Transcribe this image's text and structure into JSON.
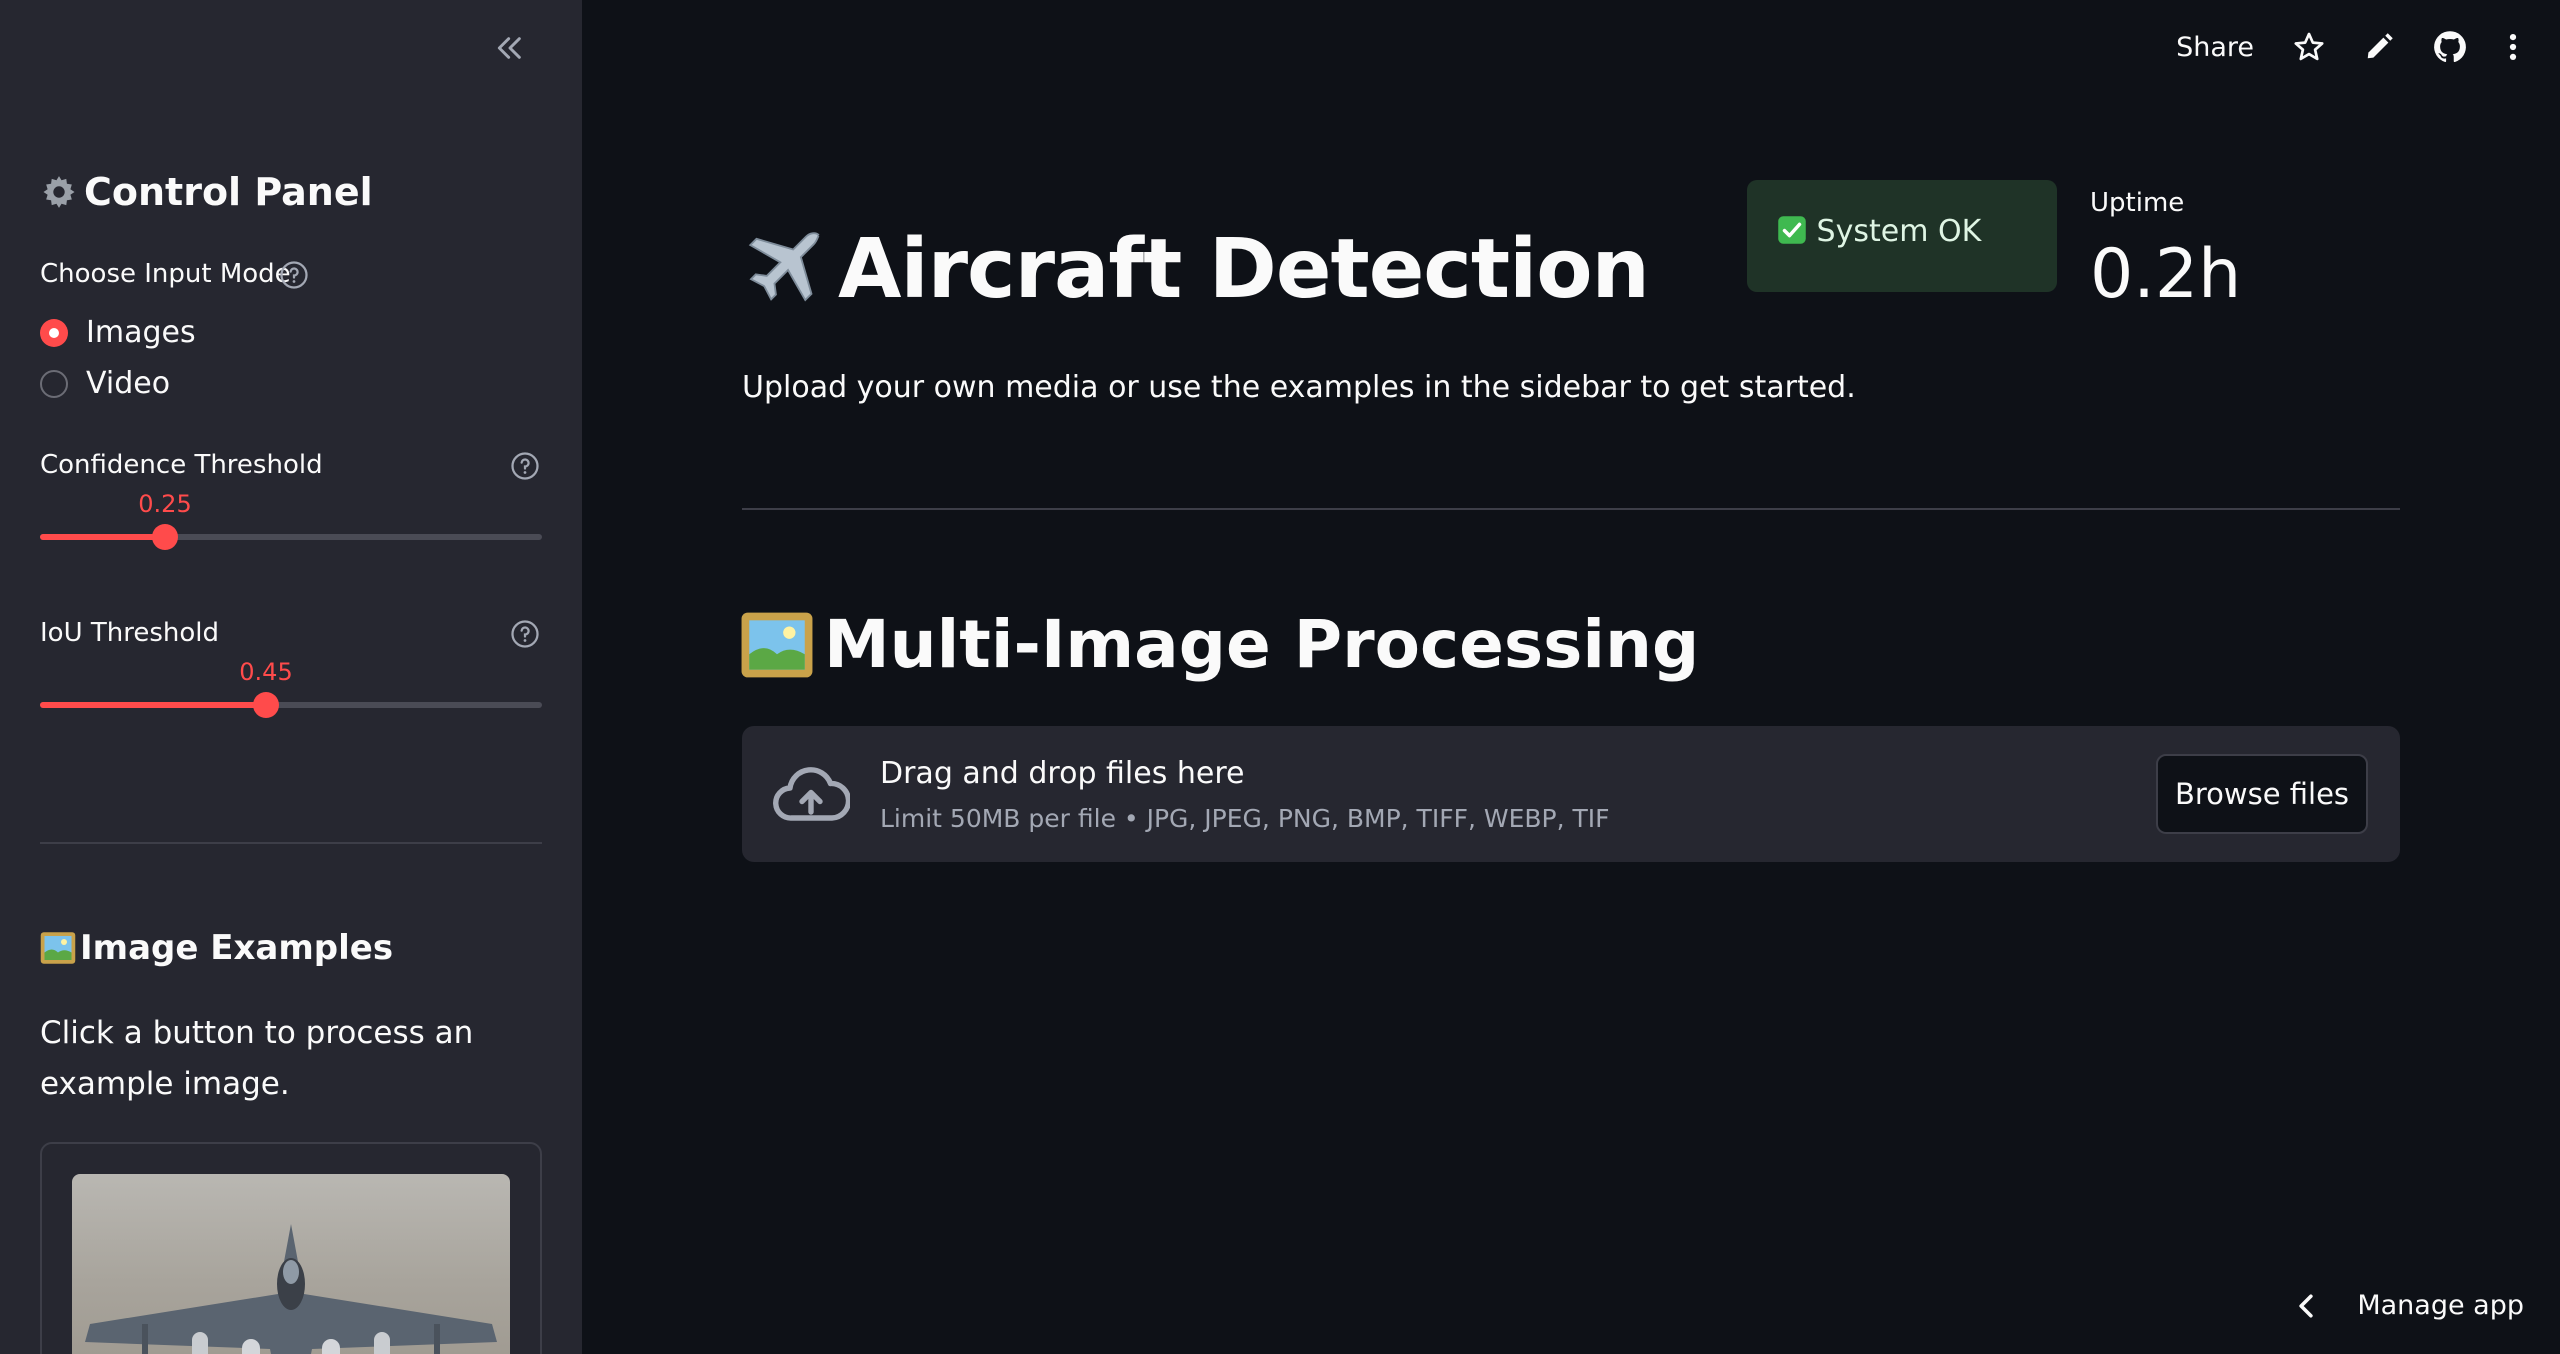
{
  "sidebar": {
    "title_icon": "gear-icon",
    "title": "Control Panel",
    "input_mode_label": "Choose Input Mode",
    "input_mode_options": [
      "Images",
      "Video"
    ],
    "input_mode_selected": "Images",
    "confidence_label": "Confidence Threshold",
    "confidence_value": "0.25",
    "iou_label": "IoU Threshold",
    "iou_value": "0.45",
    "examples_icon": "framed-picture-icon",
    "examples_title": "Image Examples",
    "examples_text": "Click a button to process an example image."
  },
  "toolbar": {
    "share_label": "Share",
    "icons": [
      "star-icon",
      "pencil-icon",
      "github-icon",
      "kebab-menu-icon"
    ]
  },
  "main": {
    "title_icon": "airplane-icon",
    "title": "Aircraft Detection",
    "subtitle": "Upload your own media or use the examples in the sidebar to get started.",
    "status": {
      "icon": "check-mark-icon",
      "text": "System OK"
    },
    "uptime_label": "Uptime",
    "uptime_value": "0.2h",
    "section_icon": "framed-picture-icon",
    "section_title": "Multi-Image Processing",
    "uploader": {
      "title": "Drag and drop files here",
      "limits": "Limit 50MB per file • JPG, JPEG, PNG, BMP, TIFF, WEBP, TIF",
      "browse_label": "Browse files"
    }
  },
  "footer": {
    "manage_label": "Manage app"
  },
  "colors": {
    "background": "#0e1117",
    "sidebar": "#262730",
    "accent": "#ff4b4b",
    "status_bg": "#1f3327"
  }
}
